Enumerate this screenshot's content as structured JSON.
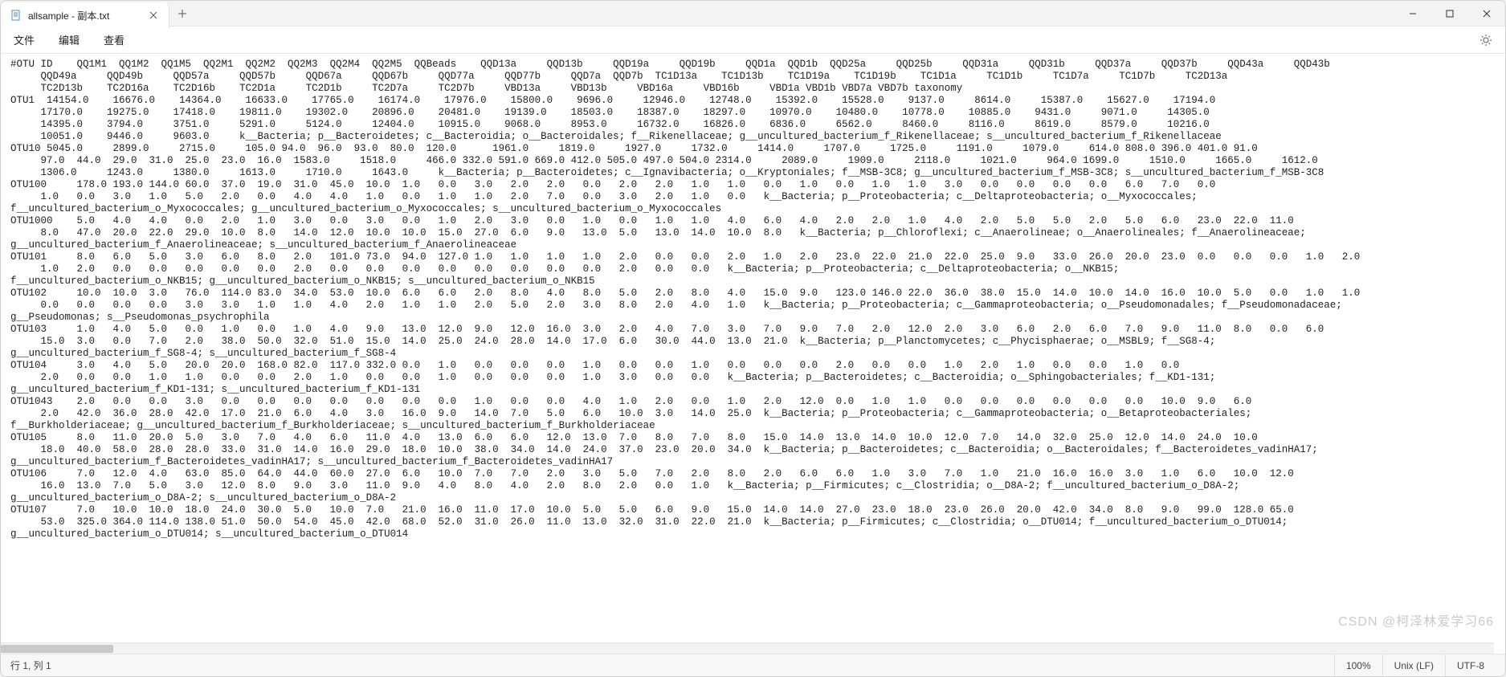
{
  "window": {
    "tab_title": "allsample - 副本.txt",
    "menu": {
      "file": "文件",
      "edit": "编辑",
      "view": "查看"
    }
  },
  "statusbar": {
    "cursor": "行 1, 列 1",
    "zoom": "100%",
    "eol": "Unix (LF)",
    "encoding": "UTF-8"
  },
  "watermark": "CSDN @柯泽林爱学习66",
  "content_lines": [
    "#OTU ID    QQ1M1  QQ1M2  QQ1M5  QQ2M1  QQ2M2  QQ2M3  QQ2M4  QQ2M5  QQBeads    QQD13a     QQD13b     QQD19a     QQD19b     QQD1a  QQD1b  QQD25a     QQD25b     QQD31a     QQD31b     QQD37a     QQD37b     QQD43a     QQD43b",
    "     QQD49a     QQD49b     QQD57a     QQD57b     QQD67a     QQD67b     QQD77a     QQD77b     QQD7a  QQD7b  TC1D13a    TC1D13b    TC1D19a    TC1D19b    TC1D1a     TC1D1b     TC1D7a     TC1D7b     TC2D13a",
    "     TC2D13b    TC2D16a    TC2D16b    TC2D1a     TC2D1b     TC2D7a     TC2D7b     VBD13a     VBD13b     VBD16a     VBD16b     VBD1a VBD1b VBD7a VBD7b taxonomy",
    "OTU1  14154.0    16676.0    14364.0    16633.0    17765.0    16174.0    17976.0    15800.0    9696.0     12946.0    12748.0    15392.0    15528.0    9137.0     8614.0     15387.0    15627.0    17194.0",
    "     17170.0    19275.0    17418.0    19811.0    19302.0    20896.0    20481.0    19139.0    18503.0    18387.0    18297.0    10970.0    10480.0    10778.0    10885.0    9431.0     9071.0     14305.0",
    "     14395.0    3794.0     3751.0     5291.0     5124.0     12404.0    10915.0    9068.0     8953.0     16732.0    16826.0    6836.0     6562.0     8460.0     8116.0     8619.0     8579.0     10216.0",
    "     10051.0    9446.0     9603.0     k__Bacteria; p__Bacteroidetes; c__Bacteroidia; o__Bacteroidales; f__Rikenellaceae; g__uncultured_bacterium_f_Rikenellaceae; s__uncultured_bacterium_f_Rikenellaceae",
    "OTU10 5045.0     2899.0     2715.0     105.0 94.0  96.0  93.0  80.0  120.0      1961.0     1819.0     1927.0     1732.0     1414.0     1707.0     1725.0     1191.0     1079.0     614.0 808.0 396.0 401.0 91.0",
    "     97.0  44.0  29.0  31.0  25.0  23.0  16.0  1583.0     1518.0     466.0 332.0 591.0 669.0 412.0 505.0 497.0 504.0 2314.0     2089.0     1909.0     2118.0     1021.0     964.0 1699.0     1510.0     1665.0     1612.0",
    "     1306.0     1243.0     1380.0     1613.0     1710.0     1643.0     k__Bacteria; p__Bacteroidetes; c__Ignavibacteria; o__Kryptoniales; f__MSB-3C8; g__uncultured_bacterium_f_MSB-3C8; s__uncultured_bacterium_f_MSB-3C8",
    "OTU100     178.0 193.0 144.0 60.0  37.0  19.0  31.0  45.0  10.0  1.0   0.0   3.0   2.0   2.0   0.0   2.0   2.0   1.0   1.0   0.0   1.0   0.0   1.0   1.0   3.0   0.0   0.0   0.0   0.0   6.0   7.0   0.0",
    "     1.0   0.0   3.0   1.0   5.0   2.0   0.0   4.0   4.0   1.0   0.0   1.0   1.0   2.0   7.0   0.0   3.0   2.0   1.0   0.0   k__Bacteria; p__Proteobacteria; c__Deltaproteobacteria; o__Myxococcales;",
    "f__uncultured_bacterium_o_Myxococcales; g__uncultured_bacterium_o_Myxococcales; s__uncultured_bacterium_o_Myxococcales",
    "OTU1000    5.0   4.0   4.0   0.0   2.0   1.0   3.0   0.0   3.0   0.0   1.0   2.0   3.0   0.0   1.0   0.0   1.0   1.0   4.0   6.0   4.0   2.0   2.0   1.0   4.0   2.0   5.0   5.0   2.0   5.0   6.0   23.0  22.0  11.0",
    "     8.0   47.0  20.0  22.0  29.0  10.0  8.0   14.0  12.0  10.0  10.0  15.0  27.0  6.0   9.0   13.0  5.0   13.0  14.0  10.0  8.0   k__Bacteria; p__Chloroflexi; c__Anaerolineae; o__Anaerolineales; f__Anaerolineaceae;",
    "g__uncultured_bacterium_f_Anaerolineaceae; s__uncultured_bacterium_f_Anaerolineaceae",
    "OTU101     8.0   6.0   5.0   3.0   6.0   8.0   2.0   101.0 73.0  94.0  127.0 1.0   1.0   1.0   1.0   2.0   0.0   0.0   2.0   1.0   2.0   23.0  22.0  21.0  22.0  25.0  9.0   33.0  26.0  20.0  23.0  0.0   0.0   0.0   1.0   2.0",
    "     1.0   2.0   0.0   0.0   0.0   0.0   0.0   2.0   0.0   0.0   0.0   0.0   0.0   0.0   0.0   0.0   2.0   0.0   0.0   k__Bacteria; p__Proteobacteria; c__Deltaproteobacteria; o__NKB15;",
    "f__uncultured_bacterium_o_NKB15; g__uncultured_bacterium_o_NKB15; s__uncultured_bacterium_o_NKB15",
    "OTU102     10.0  10.0  3.0   76.0  114.0 83.0  34.0  53.0  10.0  6.0   6.0   2.0   8.0   4.0   8.0   5.0   2.0   8.0   4.0   15.0  9.0   123.0 146.0 22.0  36.0  38.0  15.0  14.0  10.0  14.0  16.0  10.0  5.0   0.0   1.0   1.0",
    "     0.0   0.0   0.0   0.0   3.0   3.0   1.0   1.0   4.0   2.0   1.0   1.0   2.0   5.0   2.0   3.0   8.0   2.0   4.0   1.0   k__Bacteria; p__Proteobacteria; c__Gammaproteobacteria; o__Pseudomonadales; f__Pseudomonadaceae;",
    "g__Pseudomonas; s__Pseudomonas_psychrophila",
    "OTU103     1.0   4.0   5.0   0.0   1.0   0.0   1.0   4.0   9.0   13.0  12.0  9.0   12.0  16.0  3.0   2.0   4.0   7.0   3.0   7.0   9.0   7.0   2.0   12.0  2.0   3.0   6.0   2.0   6.0   7.0   9.0   11.0  8.0   0.0   6.0",
    "     15.0  3.0   0.0   7.0   2.0   38.0  50.0  32.0  51.0  15.0  14.0  25.0  24.0  28.0  14.0  17.0  6.0   30.0  44.0  13.0  21.0  k__Bacteria; p__Planctomycetes; c__Phycisphaerae; o__MSBL9; f__SG8-4;",
    "g__uncultured_bacterium_f_SG8-4; s__uncultured_bacterium_f_SG8-4",
    "OTU104     3.0   4.0   5.0   20.0  20.0  168.0 82.0  117.0 332.0 0.0   1.0   0.0   0.0   0.0   1.0   0.0   0.0   1.0   0.0   0.0   0.0   2.0   0.0   0.0   1.0   2.0   1.0   0.0   0.0   1.0   0.0",
    "     2.0   0.0   0.0   1.0   1.0   0.0   0.0   2.0   1.0   0.0   0.0   1.0   0.0   0.0   0.0   1.0   3.0   0.0   0.0   k__Bacteria; p__Bacteroidetes; c__Bacteroidia; o__Sphingobacteriales; f__KD1-131;",
    "g__uncultured_bacterium_f_KD1-131; s__uncultured_bacterium_f_KD1-131",
    "OTU1043    2.0   0.0   0.0   3.0   0.0   0.0   0.0   0.0   0.0   0.0   0.0   1.0   0.0   0.0   4.0   1.0   2.0   0.0   1.0   2.0   12.0  0.0   1.0   1.0   0.0   0.0   0.0   0.0   0.0   0.0   10.0  9.0   6.0",
    "     2.0   42.0  36.0  28.0  42.0  17.0  21.0  6.0   4.0   3.0   16.0  9.0   14.0  7.0   5.0   6.0   10.0  3.0   14.0  25.0  k__Bacteria; p__Proteobacteria; c__Gammaproteobacteria; o__Betaproteobacteriales;",
    "f__Burkholderiaceae; g__uncultured_bacterium_f_Burkholderiaceae; s__uncultured_bacterium_f_Burkholderiaceae",
    "OTU105     8.0   11.0  20.0  5.0   3.0   7.0   4.0   6.0   11.0  4.0   13.0  6.0   6.0   12.0  13.0  7.0   8.0   7.0   8.0   15.0  14.0  13.0  14.0  10.0  12.0  7.0   14.0  32.0  25.0  12.0  14.0  24.0  10.0",
    "     18.0  40.0  58.0  28.0  28.0  33.0  31.0  14.0  16.0  29.0  18.0  10.0  38.0  34.0  14.0  24.0  37.0  23.0  20.0  34.0  k__Bacteria; p__Bacteroidetes; c__Bacteroidia; o__Bacteroidales; f__Bacteroidetes_vadinHA17;",
    "g__uncultured_bacterium_f_Bacteroidetes_vadinHA17; s__uncultured_bacterium_f_Bacteroidetes_vadinHA17",
    "OTU106     7.0   12.0  4.0   63.0  85.0  64.0  44.0  60.0  27.0  6.0   10.0  7.0   7.0   2.0   3.0   5.0   7.0   2.0   8.0   2.0   6.0   6.0   1.0   3.0   7.0   1.0   21.0  16.0  16.0  3.0   1.0   6.0   10.0  12.0",
    "     16.0  13.0  7.0   5.0   3.0   12.0  8.0   9.0   3.0   11.0  9.0   4.0   8.0   4.0   2.0   8.0   2.0   0.0   1.0   k__Bacteria; p__Firmicutes; c__Clostridia; o__D8A-2; f__uncultured_bacterium_o_D8A-2;",
    "g__uncultured_bacterium_o_D8A-2; s__uncultured_bacterium_o_D8A-2",
    "OTU107     7.0   10.0  10.0  18.0  24.0  30.0  5.0   10.0  7.0   21.0  16.0  11.0  17.0  10.0  5.0   5.0   6.0   9.0   15.0  14.0  14.0  27.0  23.0  18.0  23.0  26.0  20.0  42.0  34.0  8.0   9.0   99.0  128.0 65.0",
    "     53.0  325.0 364.0 114.0 138.0 51.0  50.0  54.0  45.0  42.0  68.0  52.0  31.0  26.0  11.0  13.0  32.0  31.0  22.0  21.0  k__Bacteria; p__Firmicutes; c__Clostridia; o__DTU014; f__uncultured_bacterium_o_DTU014;",
    "g__uncultured_bacterium_o_DTU014; s__uncultured_bacterium_o_DTU014"
  ]
}
